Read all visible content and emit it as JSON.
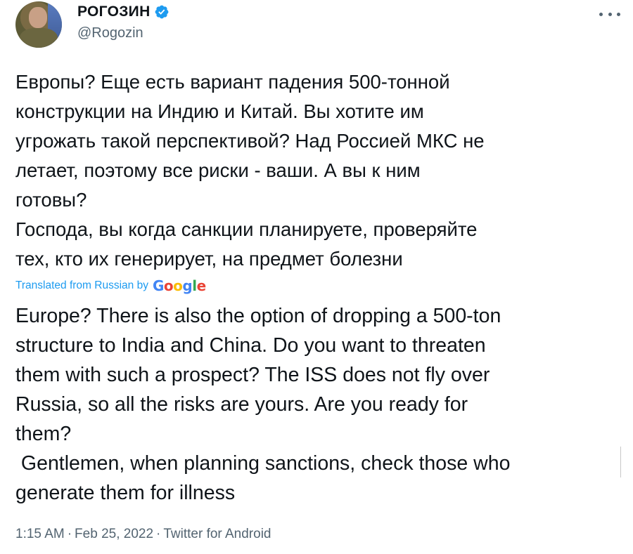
{
  "author": {
    "display_name": "РОГОЗИН",
    "handle": "@Rogozin",
    "verified": true,
    "avatar": "avatar-photo",
    "verified_color": "#1d9bf0"
  },
  "menu": {
    "icon": "more-horizontal-icon"
  },
  "tweet": {
    "original_text": "Европы? Еще есть вариант падения 500-тонной\nконструкции на Индию и Китай. Вы хотите им\nугрожать такой перспективой? Над Россией МКС не\nлетает, поэтому все риски - ваши. А вы к ним\nготовы?\nГоспода, вы когда санкции планируете, проверяйте\nтех, кто их генерирует, на предмет болезни",
    "translated_label": "Translated from Russian by",
    "translator_logo": "Google",
    "translated_text": "Europe? There is also the option of dropping a 500-ton\nstructure to India and China. Do you want to threaten\nthem with such a prospect? The ISS does not fly over\nRussia, so all the risks are yours. Are you ready for\nthem?\n Gentlemen, when planning sanctions, check those who\ngenerate them for illness"
  },
  "meta": {
    "time": "1:15 AM",
    "date": "Feb 25, 2022",
    "source": "Twitter for Android",
    "separator": "·"
  },
  "colors": {
    "text": "#0f1419",
    "secondary": "#536471",
    "link": "#1d9bf0"
  }
}
